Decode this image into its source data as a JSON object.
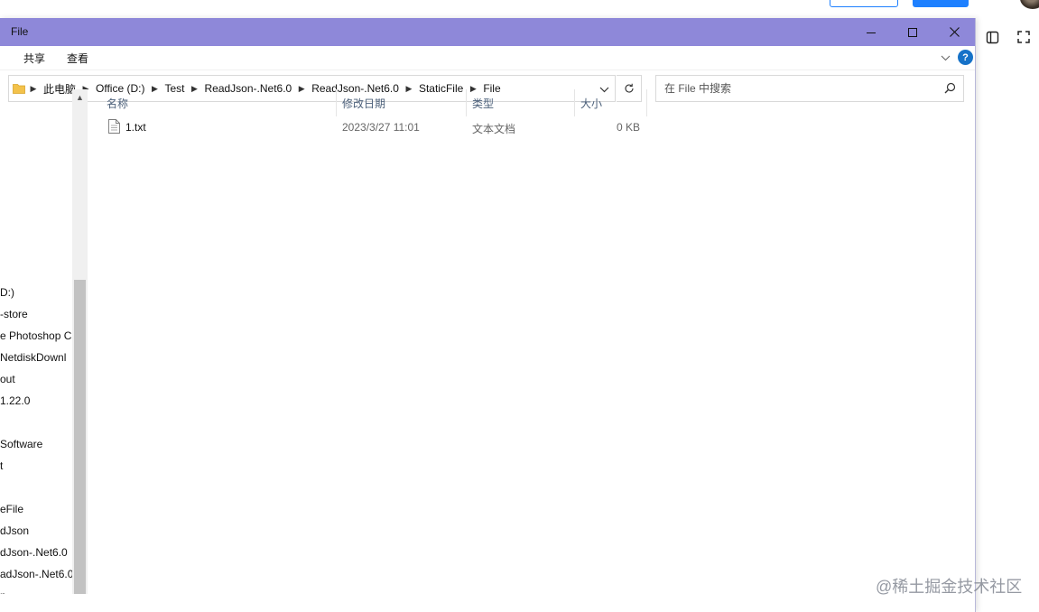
{
  "window": {
    "title": "File",
    "ribbon_tabs": [
      "共享",
      "查看"
    ]
  },
  "address": {
    "crumbs": [
      "此电脑",
      "Office (D:)",
      "Test",
      "ReadJson-.Net6.0",
      "ReadJson-.Net6.0",
      "StaticFile",
      "File"
    ]
  },
  "search": {
    "placeholder": "在 File 中搜索"
  },
  "nav": {
    "items": [
      "D:)",
      "-store",
      "e Photoshop C",
      "NetdiskDownl",
      "out",
      "1.22.0",
      "Software",
      "t",
      "eFile",
      "dJson",
      "dJson-.Net6.0",
      "adJson-.Net6.0",
      "n"
    ]
  },
  "columns": {
    "name": "名称",
    "modified": "修改日期",
    "type": "类型",
    "size": "大小"
  },
  "files": [
    {
      "name": "1.txt",
      "modified": "2023/3/27 11:01",
      "type": "文本文档",
      "size": "0 KB"
    }
  ],
  "watermark": "@稀土掘金技术社区",
  "colors": {
    "titlebar": "#8e88d9",
    "help_button": "#1672c8",
    "header_text": "#4c607a",
    "folder": "#f3c24b"
  }
}
